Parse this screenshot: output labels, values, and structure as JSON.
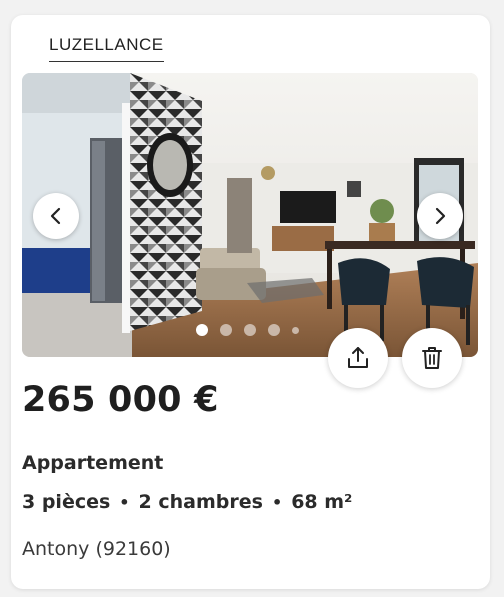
{
  "listing": {
    "agency": "LUZELLANCE",
    "price": "265 000 €",
    "property_type": "Appartement",
    "features": [
      "3 pièces",
      "2 chambres",
      "68 m²"
    ],
    "feature_separator": "•",
    "location": "Antony (92160)"
  },
  "gallery": {
    "photo_count": 5,
    "active_photo": 1,
    "prev_icon": "chevron-left-icon",
    "next_icon": "chevron-right-icon"
  },
  "actions": {
    "share_icon": "share-icon",
    "delete_icon": "trash-icon"
  },
  "colors": {
    "text": "#2b2b2b",
    "card": "#ffffff",
    "background": "#f2f2f2"
  }
}
